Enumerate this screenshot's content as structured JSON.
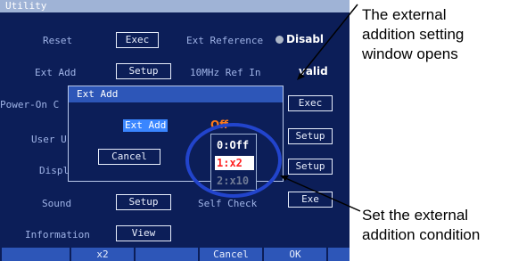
{
  "window": {
    "title": "Utility"
  },
  "rows": {
    "reset": {
      "label": "Reset",
      "button": "Exec"
    },
    "ext_add": {
      "label": "Ext Add",
      "button": "Setup"
    },
    "power_on": {
      "label": "Power-On C"
    },
    "user": {
      "label": "User Ur"
    },
    "display": {
      "label": "Displa"
    },
    "sound": {
      "label": "Sound",
      "button": "Setup"
    },
    "information": {
      "label": "Information",
      "button": "View"
    }
  },
  "right_column": {
    "ext_reference_label": "Ext Reference",
    "ext_reference_value": "Disabl",
    "ref_in_label": "10MHz Ref In",
    "ref_in_value": "valid",
    "exec_button": "Exec",
    "setup_button_1": "Setup",
    "setup_button_2": "Setup",
    "self_check_label": "Self Check",
    "self_check_button": "Exe"
  },
  "dialog": {
    "title": "Ext Add",
    "field_label": "Ext Add",
    "field_value": "Off",
    "cancel_button": "Cancel"
  },
  "dropdown": {
    "options": [
      "0:Off",
      "1:x2",
      "2:x10"
    ],
    "selected": "1:x2"
  },
  "softkeys": {
    "key2": "x2",
    "cancel": "Cancel",
    "ok": "OK"
  },
  "callouts": {
    "top": [
      "The external",
      "addition setting",
      "window opens"
    ],
    "bottom": [
      "Set the external",
      "addition condition"
    ]
  },
  "colors": {
    "screen_bg": "#0c1e58",
    "highlight": "#3a86ff",
    "selection": "#ff2020",
    "circle": "#2244cc"
  }
}
